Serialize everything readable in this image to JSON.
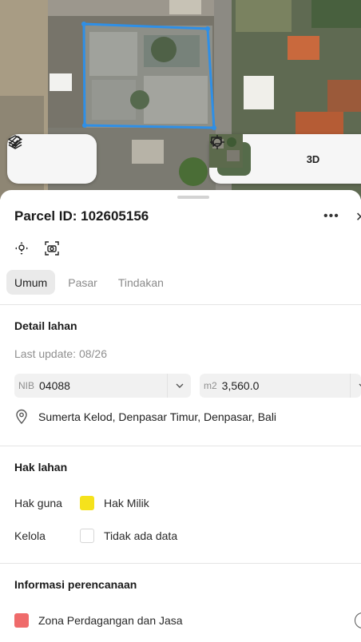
{
  "parcel": {
    "title": "Parcel ID: 102605156"
  },
  "map_controls": {
    "layers_icon": "layers-icon",
    "draw_icon": "draw-icon",
    "locate_icon": "crosshair-icon",
    "three_d_label": "3D",
    "feedback_icon": "chat-icon"
  },
  "tabs": [
    {
      "label": "Umum",
      "active": true
    },
    {
      "label": "Pasar",
      "active": false
    },
    {
      "label": "Tindakan",
      "active": false
    }
  ],
  "detail": {
    "heading": "Detail lahan",
    "last_update": "Last update: 08/26",
    "nib_prefix": "NIB",
    "nib_value": "04088",
    "area_prefix": "m2",
    "area_value": "3,560.0",
    "address": "Sumerta Kelod, Denpasar Timur, Denpasar, Bali"
  },
  "rights": {
    "heading": "Hak lahan",
    "rows": [
      {
        "label": "Hak guna",
        "value": "Hak Milik",
        "color": "#f5e21c"
      },
      {
        "label": "Kelola",
        "value": "Tidak ada data",
        "color": "#ffffff"
      }
    ]
  },
  "planning": {
    "heading": "Informasi perencanaan",
    "zone": "Zona Perdagangan dan Jasa",
    "zone_color": "#ef6b6b"
  },
  "colors": {
    "parcel_outline": "#2f8fe6",
    "accent_text": "#1b1b1b"
  }
}
